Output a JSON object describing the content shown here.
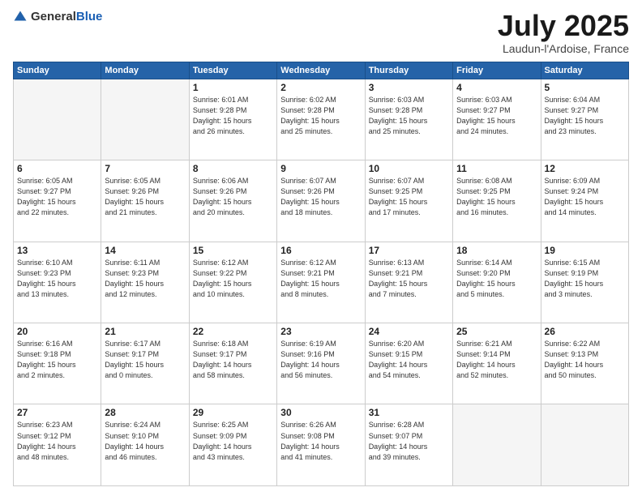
{
  "logo": {
    "general": "General",
    "blue": "Blue"
  },
  "title": "July 2025",
  "location": "Laudun-l'Ardoise, France",
  "weekdays": [
    "Sunday",
    "Monday",
    "Tuesday",
    "Wednesday",
    "Thursday",
    "Friday",
    "Saturday"
  ],
  "days": [
    {
      "num": "",
      "info": ""
    },
    {
      "num": "",
      "info": ""
    },
    {
      "num": "1",
      "info": "Sunrise: 6:01 AM\nSunset: 9:28 PM\nDaylight: 15 hours\nand 26 minutes."
    },
    {
      "num": "2",
      "info": "Sunrise: 6:02 AM\nSunset: 9:28 PM\nDaylight: 15 hours\nand 25 minutes."
    },
    {
      "num": "3",
      "info": "Sunrise: 6:03 AM\nSunset: 9:28 PM\nDaylight: 15 hours\nand 25 minutes."
    },
    {
      "num": "4",
      "info": "Sunrise: 6:03 AM\nSunset: 9:27 PM\nDaylight: 15 hours\nand 24 minutes."
    },
    {
      "num": "5",
      "info": "Sunrise: 6:04 AM\nSunset: 9:27 PM\nDaylight: 15 hours\nand 23 minutes."
    },
    {
      "num": "6",
      "info": "Sunrise: 6:05 AM\nSunset: 9:27 PM\nDaylight: 15 hours\nand 22 minutes."
    },
    {
      "num": "7",
      "info": "Sunrise: 6:05 AM\nSunset: 9:26 PM\nDaylight: 15 hours\nand 21 minutes."
    },
    {
      "num": "8",
      "info": "Sunrise: 6:06 AM\nSunset: 9:26 PM\nDaylight: 15 hours\nand 20 minutes."
    },
    {
      "num": "9",
      "info": "Sunrise: 6:07 AM\nSunset: 9:26 PM\nDaylight: 15 hours\nand 18 minutes."
    },
    {
      "num": "10",
      "info": "Sunrise: 6:07 AM\nSunset: 9:25 PM\nDaylight: 15 hours\nand 17 minutes."
    },
    {
      "num": "11",
      "info": "Sunrise: 6:08 AM\nSunset: 9:25 PM\nDaylight: 15 hours\nand 16 minutes."
    },
    {
      "num": "12",
      "info": "Sunrise: 6:09 AM\nSunset: 9:24 PM\nDaylight: 15 hours\nand 14 minutes."
    },
    {
      "num": "13",
      "info": "Sunrise: 6:10 AM\nSunset: 9:23 PM\nDaylight: 15 hours\nand 13 minutes."
    },
    {
      "num": "14",
      "info": "Sunrise: 6:11 AM\nSunset: 9:23 PM\nDaylight: 15 hours\nand 12 minutes."
    },
    {
      "num": "15",
      "info": "Sunrise: 6:12 AM\nSunset: 9:22 PM\nDaylight: 15 hours\nand 10 minutes."
    },
    {
      "num": "16",
      "info": "Sunrise: 6:12 AM\nSunset: 9:21 PM\nDaylight: 15 hours\nand 8 minutes."
    },
    {
      "num": "17",
      "info": "Sunrise: 6:13 AM\nSunset: 9:21 PM\nDaylight: 15 hours\nand 7 minutes."
    },
    {
      "num": "18",
      "info": "Sunrise: 6:14 AM\nSunset: 9:20 PM\nDaylight: 15 hours\nand 5 minutes."
    },
    {
      "num": "19",
      "info": "Sunrise: 6:15 AM\nSunset: 9:19 PM\nDaylight: 15 hours\nand 3 minutes."
    },
    {
      "num": "20",
      "info": "Sunrise: 6:16 AM\nSunset: 9:18 PM\nDaylight: 15 hours\nand 2 minutes."
    },
    {
      "num": "21",
      "info": "Sunrise: 6:17 AM\nSunset: 9:17 PM\nDaylight: 15 hours\nand 0 minutes."
    },
    {
      "num": "22",
      "info": "Sunrise: 6:18 AM\nSunset: 9:17 PM\nDaylight: 14 hours\nand 58 minutes."
    },
    {
      "num": "23",
      "info": "Sunrise: 6:19 AM\nSunset: 9:16 PM\nDaylight: 14 hours\nand 56 minutes."
    },
    {
      "num": "24",
      "info": "Sunrise: 6:20 AM\nSunset: 9:15 PM\nDaylight: 14 hours\nand 54 minutes."
    },
    {
      "num": "25",
      "info": "Sunrise: 6:21 AM\nSunset: 9:14 PM\nDaylight: 14 hours\nand 52 minutes."
    },
    {
      "num": "26",
      "info": "Sunrise: 6:22 AM\nSunset: 9:13 PM\nDaylight: 14 hours\nand 50 minutes."
    },
    {
      "num": "27",
      "info": "Sunrise: 6:23 AM\nSunset: 9:12 PM\nDaylight: 14 hours\nand 48 minutes."
    },
    {
      "num": "28",
      "info": "Sunrise: 6:24 AM\nSunset: 9:10 PM\nDaylight: 14 hours\nand 46 minutes."
    },
    {
      "num": "29",
      "info": "Sunrise: 6:25 AM\nSunset: 9:09 PM\nDaylight: 14 hours\nand 43 minutes."
    },
    {
      "num": "30",
      "info": "Sunrise: 6:26 AM\nSunset: 9:08 PM\nDaylight: 14 hours\nand 41 minutes."
    },
    {
      "num": "31",
      "info": "Sunrise: 6:28 AM\nSunset: 9:07 PM\nDaylight: 14 hours\nand 39 minutes."
    },
    {
      "num": "",
      "info": ""
    },
    {
      "num": "",
      "info": ""
    }
  ]
}
